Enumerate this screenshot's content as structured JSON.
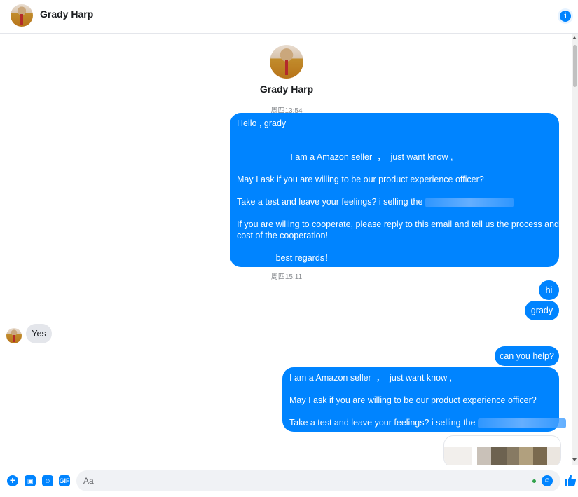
{
  "header": {
    "name": "Grady Harp"
  },
  "profile": {
    "name": "Grady Harp"
  },
  "timestamps": [
    "周四13:54",
    "周四15:11"
  ],
  "messages": {
    "m1": [
      "Hello , grady",
      "",
      "",
      "                      I am a Amazon seller  ，  just want know ,",
      "",
      "May I ask if you are willing to be our product experience officer?",
      "",
      "Take a test and leave your feelings? i selling the ",
      "",
      "If you are willing to cooperate, please reply to this email and tell us the process and",
      "cost of the cooperation!",
      "",
      "                best regards！"
    ],
    "m2": "hi",
    "m3": "grady",
    "m4": "Yes",
    "m5": "can you help?",
    "m6": [
      "I am a Amazon seller  ，  just want know ,",
      "",
      "May I ask if you are willing to be our product experience officer?",
      "",
      "Take a test and leave your feelings? i selling the "
    ]
  },
  "composer": {
    "placeholder": "Aa"
  },
  "colors": {
    "accent": "#0084ff",
    "incoming": "#e4e6eb"
  },
  "icons": [
    "info-icon",
    "plus-icon",
    "image-icon",
    "sticker-icon",
    "gif-icon",
    "emoji-icon",
    "thumbs-up-icon"
  ]
}
